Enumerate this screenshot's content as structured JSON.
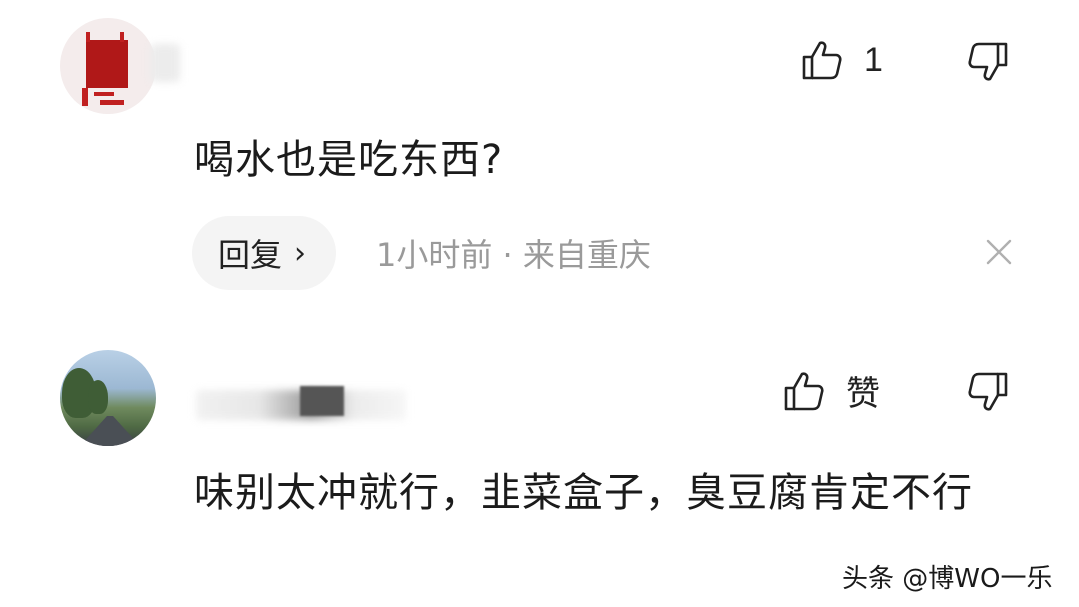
{
  "comments": [
    {
      "avatar_icon": "user-avatar-red-artwork",
      "like_count": "1",
      "text": "喝水也是吃东西?",
      "reply_label": "回复",
      "reply_chevron": "›",
      "meta": "1小时前 · 来自重庆"
    },
    {
      "avatar_icon": "user-avatar-tree-road-photo",
      "like_label": "赞",
      "text": "味别太冲就行，韭菜盒子，臭豆腐肯定不行"
    }
  ],
  "icons": {
    "like": "thumbs-up-icon",
    "dislike": "thumbs-down-icon",
    "close": "close-icon"
  },
  "colors": {
    "text": "#1b1b1b",
    "meta": "#9a9a9a",
    "reply_bg": "#f4f4f4",
    "icon": "#222222"
  },
  "watermark": "头条 @博WO一乐"
}
